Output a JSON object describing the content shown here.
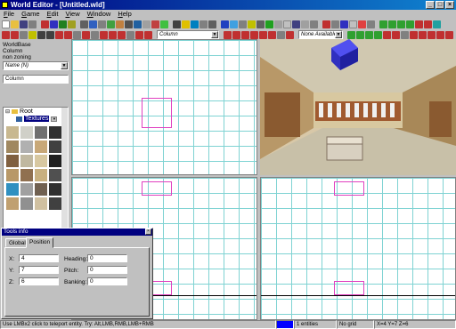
{
  "window": {
    "title": "World Editor - [Untitled.wld]",
    "buttons": [
      "_",
      "□",
      "×"
    ]
  },
  "menu": [
    "File",
    "Game",
    "Edit",
    "View",
    "Window",
    "Help"
  ],
  "toolbar2": {
    "object_combo": "Column",
    "zoning_combo": "None Available"
  },
  "left_panel": {
    "line1": "WorldBase",
    "line2": "Column",
    "line3": "non zoning",
    "filter_value": "Name (N)",
    "entity_value": "Column",
    "tree_root": "Root",
    "tree_child": "Textures"
  },
  "tools_info": {
    "title": "Tools info",
    "tabs": [
      "Global",
      "Position"
    ],
    "x_label": "X:",
    "x_value": "4",
    "y_label": "Y:",
    "y_value": "7",
    "z_label": "Z:",
    "z_value": "6",
    "heading_label": "Heading:",
    "heading_value": "0",
    "pitch_label": "Pitch:",
    "pitch_value": "0",
    "banking_label": "Banking:",
    "banking_value": "0"
  },
  "status": {
    "hint": "Use LMBx2 click to teleport entity. Try: Alt,LMB,RMB,LMB+RMB",
    "entities": "1 entities",
    "grid": "No grid",
    "coords": "X=4 Y=7 Z=6"
  },
  "colors": {
    "title_bar": "#000080",
    "grid_line": "#7fd3d3",
    "entity_box": "#e040c0",
    "status_blue": "#0000ff"
  }
}
